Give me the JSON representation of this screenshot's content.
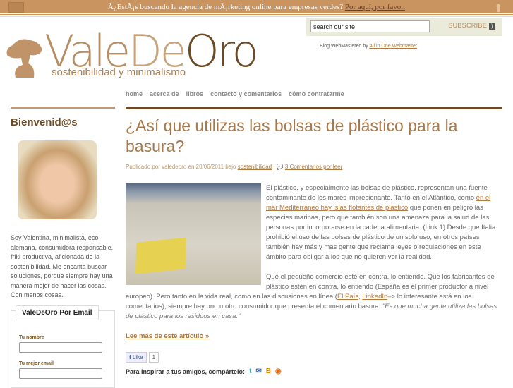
{
  "topbar": {
    "message": "Â¿EstÃ¡s buscando la agencia de mÃ¡rketing online para empresas verdes?",
    "link": "Por aquí, por favor."
  },
  "search": {
    "placeholder": "search our site",
    "value": "search our site",
    "subscribe": "SUBSCRIBE"
  },
  "webmaster": {
    "text": "Blog WebMastered by",
    "link": "All in One Webmaster",
    "suffix": "."
  },
  "logo": {
    "name_a": "Vale",
    "name_b": "De",
    "name_c": "Oro",
    "tagline": "sostenibilidad y minimalismo"
  },
  "nav": [
    "home",
    "acerca de",
    "libros",
    "contacto y comentarios",
    "cómo contratarme"
  ],
  "sidebar": {
    "title": "Bienvenid@s",
    "bio": "Soy Valentina, minimalista, eco-alemana, consumidora responsable, friki productiva, aficionada de la sostenibilidad. Me encanta buscar soluciones, porque siempre hay una manera mejor de hacer las cosas. Con menos cosas.",
    "email_title": "ValeDeOro Por Email",
    "name_label": "Tu nombre",
    "email_label": "Tu mejor email"
  },
  "post": {
    "title": "¿Así que utilizas las bolsas de plástico para la basura?",
    "meta_prefix": "Publicado por valedeoro en 20/06/2011 bajo",
    "category": "sostenibilidad",
    "sep": "|",
    "comments": "3 Comentarios por leer",
    "p1a": "El plástico, y especialmente las bolsas de plástico, representan una fuente contaminante de los mares impresionante. Tanto en el Atlántico, como ",
    "p1link": "en el mar Mediterráneo hay islas flotantes de plástico",
    "p1b": " que ponen en peligro las especies marinas, pero que también son una amenaza para la salud de las personas por incorporarse en la cadena alimentaria. (Link 1) Desde que Italia prohibió el uso de las bolsas de plástico de un solo uso, en otros países también hay más y más gente que reclama leyes o regulaciones en este ámbito para obligar a los que no quieren ver la realidad.",
    "p2a": "Que el pequeño comercio esté en contra, lo entiendo. Que los fabricantes de plástico estén en contra, lo entiendo (España es el primer productor a nivel europeo). Pero tanto en la vida real, como en las discusiones en línea (",
    "p2link1": "El País",
    "p2comma": ", ",
    "p2link2": "LinkedIn",
    "p2b": "–> lo interesante está en los comentarios), siempre hay uno u otro consumidor que presenta el comentario basura. ",
    "p2quote": "\"Es que mucha gente utiliza las bolsas de plástico para los residuos en casa.\"",
    "more": "Lee más de este artículo »",
    "like": "Like",
    "like_count": "1",
    "share": "Para inspirar a tus amigos, compártelo:"
  }
}
